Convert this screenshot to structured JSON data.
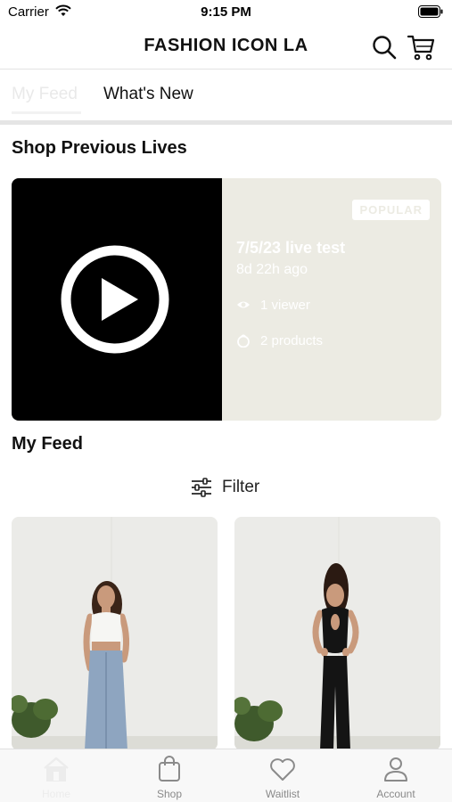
{
  "status_bar": {
    "carrier": "Carrier",
    "time": "9:15 PM"
  },
  "header": {
    "title": "FASHION ICON LA",
    "search_icon": "search-icon",
    "cart_icon": "cart-icon"
  },
  "tabs": [
    {
      "label": "My Feed",
      "active": true
    },
    {
      "label": "What's New",
      "active": false
    }
  ],
  "previous_lives": {
    "section_title": "Shop Previous Lives",
    "card": {
      "badge": "POPULAR",
      "title": "7/5/23 live test",
      "time_ago": "8d 22h ago",
      "viewers": "1 viewer",
      "products": "2 products"
    }
  },
  "feed": {
    "section_title": "My Feed",
    "filter_label": "Filter"
  },
  "products": [
    {
      "name": "product-card-1",
      "outfit": "white crop top and denim maxi skirt"
    },
    {
      "name": "product-card-2",
      "outfit": "black cutout jumpsuit"
    }
  ],
  "bottom_nav": [
    {
      "label": "Home",
      "icon": "home-icon",
      "active": true
    },
    {
      "label": "Shop",
      "icon": "bag-icon",
      "active": false
    },
    {
      "label": "Waitlist",
      "icon": "heart-icon",
      "active": false
    },
    {
      "label": "Account",
      "icon": "person-icon",
      "active": false
    }
  ],
  "colors": {
    "accent_inactive": "#ececec",
    "live_panel_bg": "#ecebe3",
    "text_primary": "#111111"
  }
}
